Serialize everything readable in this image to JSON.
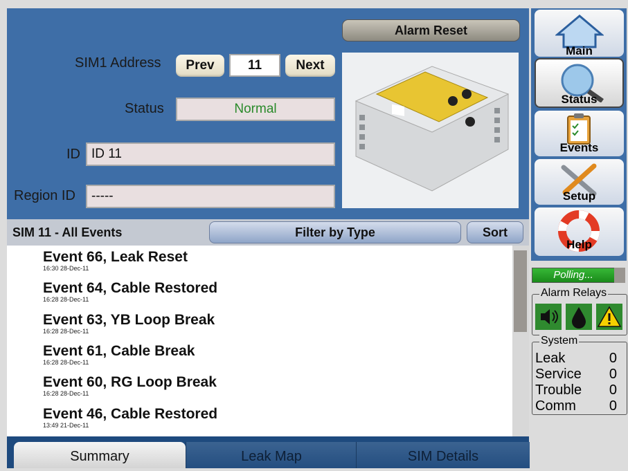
{
  "header": {
    "alarm_reset": "Alarm Reset",
    "sim_address_label": "SIM1 Address",
    "prev": "Prev",
    "address_value": "11",
    "next": "Next",
    "status_label": "Status",
    "status_value": "Normal",
    "status_color": "#2a8a2a",
    "id_label": "ID",
    "id_value": "ID 11",
    "region_label": "Region ID",
    "region_value": "-----"
  },
  "filter_bar": {
    "title": "SIM 11 - All Events",
    "filter_button": "Filter by Type",
    "sort_button": "Sort"
  },
  "events": [
    {
      "title": "Event 66, Leak Reset",
      "time": "16:30 28-Dec-11"
    },
    {
      "title": "Event 64, Cable Restored",
      "time": "16:28 28-Dec-11"
    },
    {
      "title": "Event 63, YB Loop Break",
      "time": "16:28 28-Dec-11"
    },
    {
      "title": "Event 61, Cable Break",
      "time": "16:28 28-Dec-11"
    },
    {
      "title": "Event 60, RG Loop Break",
      "time": "16:28 28-Dec-11"
    },
    {
      "title": "Event 46, Cable Restored",
      "time": "13:49 21-Dec-11"
    }
  ],
  "tabs": [
    "Summary",
    "Leak Map",
    "SIM Details"
  ],
  "nav": {
    "main": "Main",
    "status": "Status",
    "events": "Events",
    "setup": "Setup",
    "help": "Help"
  },
  "polling": "Polling...",
  "alarm_relays": {
    "label": "Alarm Relays",
    "icons": [
      "speaker-icon",
      "drop-icon",
      "warning-icon"
    ]
  },
  "system": {
    "label": "System",
    "rows": [
      {
        "name": "Leak",
        "value": "0"
      },
      {
        "name": "Service",
        "value": "0"
      },
      {
        "name": "Trouble",
        "value": "0"
      },
      {
        "name": "Comm",
        "value": "0"
      }
    ]
  },
  "colors": {
    "panel_blue": "#3e6ea7",
    "tab_bar": "#1e4a7e",
    "relay_green": "#2f8a2f",
    "polling_green": "#1f9a1f"
  }
}
